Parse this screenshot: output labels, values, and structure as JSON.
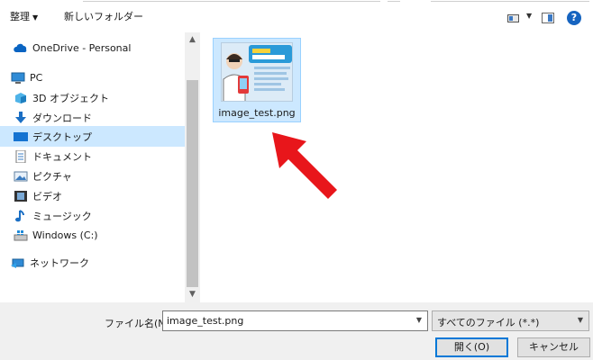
{
  "toolbar": {
    "organize_label": "整理",
    "organize_caret": "▼",
    "new_folder_label": "新しいフォルダー",
    "view_caret": "▼",
    "help_label": "?"
  },
  "nav": {
    "items": [
      {
        "label": "OneDrive - Personal",
        "icon": "cloud-icon"
      },
      {
        "label": "PC",
        "icon": "pc-icon"
      },
      {
        "label": "3D オブジェクト",
        "icon": "3d-objects-icon"
      },
      {
        "label": "ダウンロード",
        "icon": "download-icon"
      },
      {
        "label": "デスクトップ",
        "icon": "desktop-icon",
        "selected": true
      },
      {
        "label": "ドキュメント",
        "icon": "documents-icon"
      },
      {
        "label": "ピクチャ",
        "icon": "pictures-icon"
      },
      {
        "label": "ビデオ",
        "icon": "videos-icon"
      },
      {
        "label": "ミュージック",
        "icon": "music-icon"
      },
      {
        "label": "Windows (C:)",
        "icon": "drive-icon"
      },
      {
        "label": "ネットワーク",
        "icon": "network-icon"
      }
    ]
  },
  "scrollbar": {
    "up": "▲",
    "down": "▼"
  },
  "file": {
    "name": "image_test.png"
  },
  "footer": {
    "filename_label": "ファイル名(N):",
    "filename_value": "image_test.png",
    "filter_value": "すべてのファイル (*.*)",
    "open_label": "開く(O)",
    "cancel_label": "キャンセル"
  },
  "colors": {
    "selection": "#cce8ff",
    "accent": "#0078d7",
    "annotation_arrow": "#e8161b"
  }
}
